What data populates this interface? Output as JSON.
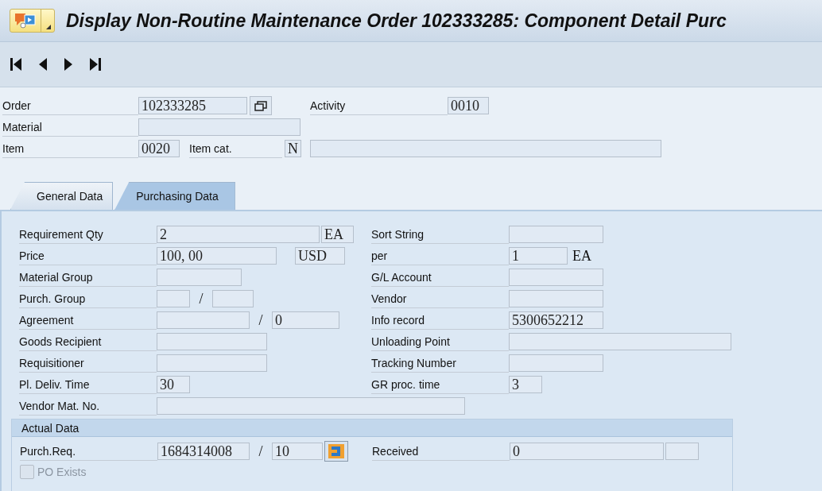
{
  "window": {
    "title": "Display Non-Routine Maintenance Order 102333285: Component Detail Purc"
  },
  "header": {
    "order": {
      "label": "Order",
      "value": "102333285"
    },
    "activity": {
      "label": "Activity",
      "value": "0010"
    },
    "material": {
      "label": "Material"
    },
    "item": {
      "label": "Item",
      "value": "0020"
    },
    "item_cat": {
      "label": "Item cat.",
      "value": "N"
    }
  },
  "tabs": [
    {
      "label": "General Data",
      "selected": false
    },
    {
      "label": "Purchasing Data",
      "selected": true
    }
  ],
  "purchasing": {
    "requirement_qty": {
      "label": "Requirement Qty",
      "value": "2",
      "unit": "EA"
    },
    "sort_string": {
      "label": "Sort String"
    },
    "price": {
      "label": "Price",
      "value": "100, 00",
      "currency": "USD"
    },
    "per": {
      "label": "per",
      "value": "1",
      "unit": "EA"
    },
    "material_group": {
      "label": "Material Group"
    },
    "gl_account": {
      "label": "G/L Account"
    },
    "purch_group": {
      "label": "Purch. Group",
      "separator": "/"
    },
    "vendor": {
      "label": "Vendor"
    },
    "agreement": {
      "label": "Agreement",
      "separator": "/",
      "item": "0"
    },
    "info_record": {
      "label": "Info record",
      "value": "5300652212"
    },
    "goods_recipient": {
      "label": "Goods Recipient"
    },
    "unloading_point": {
      "label": "Unloading Point"
    },
    "requisitioner": {
      "label": "Requisitioner"
    },
    "tracking_number": {
      "label": "Tracking Number"
    },
    "pl_deliv_time": {
      "label": "Pl. Deliv. Time",
      "value": "30"
    },
    "gr_proc_time": {
      "label": "GR proc. time",
      "value": "3"
    },
    "vendor_mat_no": {
      "label": "Vendor Mat. No."
    }
  },
  "actual_data": {
    "title": "Actual Data",
    "purch_req": {
      "label": "Purch.Req.",
      "value": "1684314008",
      "separator": "/",
      "item": "10"
    },
    "received": {
      "label": "Received",
      "value": "0"
    },
    "po_exists": {
      "label": "PO Exists",
      "checked": false,
      "disabled": true
    }
  }
}
